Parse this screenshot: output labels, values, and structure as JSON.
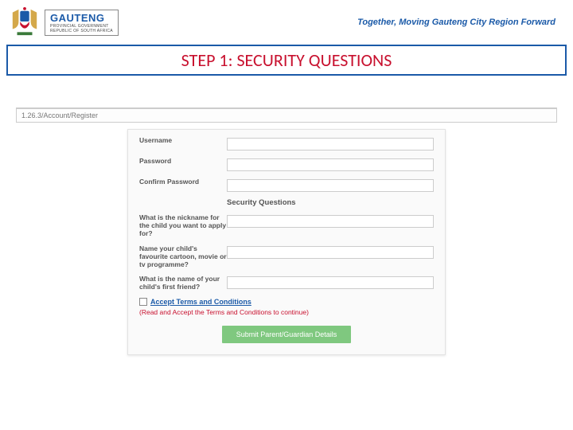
{
  "header": {
    "org_name": "GAUTENG",
    "org_sub1": "PROVINCIAL GOVERNMENT",
    "org_sub2": "REPUBLIC OF SOUTH AFRICA",
    "slogan": "Together, Moving Gauteng City Region Forward"
  },
  "step": {
    "title": "STEP 1: SECURITY QUESTIONS"
  },
  "address_bar": "1.26.3/Account/Register",
  "form": {
    "username_label": "Username",
    "username_value": "",
    "password_label": "Password",
    "password_value": "",
    "confirm_label": "Confirm Password",
    "confirm_value": "",
    "section_title": "Security Questions",
    "q1_label": "What is the nickname for the child you want to apply for?",
    "q1_value": "",
    "q2_label": "Name your child's favourite cartoon, movie or tv programme?",
    "q2_value": "",
    "q3_label": "What is the name of your child's first friend?",
    "q3_value": "",
    "terms_link": "Accept Terms and Conditions",
    "terms_hint": "(Read and Accept the Terms and Conditions to continue)",
    "submit_label": "Submit Parent/Guardian Details"
  }
}
